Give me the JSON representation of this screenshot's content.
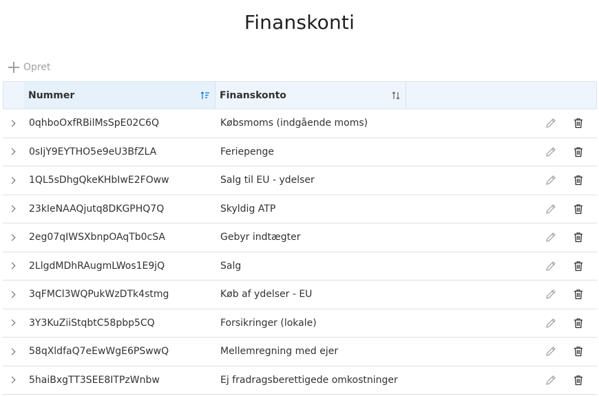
{
  "page": {
    "title": "Finanskonti"
  },
  "toolbar": {
    "create_label": "Opret"
  },
  "grid": {
    "columns": [
      {
        "label": "Nummer",
        "sort": "ascending"
      },
      {
        "label": "Finanskonto",
        "sort": "none"
      }
    ],
    "rows": [
      {
        "number": "0qhboOxfRBilMsSpE02C6Q",
        "name": "Købsmoms (indgående moms)"
      },
      {
        "number": "0sIjY9EYTHO5e9eU3BfZLA",
        "name": "Feriepenge"
      },
      {
        "number": "1QL5sDhgQkeKHbIwE2FOww",
        "name": "Salg til EU - ydelser"
      },
      {
        "number": "23kIeNAAQjutq8DKGPHQ7Q",
        "name": "Skyldig ATP"
      },
      {
        "number": "2eg07qIWSXbnpOAqTb0cSA",
        "name": "Gebyr indtægter"
      },
      {
        "number": "2LlgdMDhRAugmLWos1E9jQ",
        "name": "Salg"
      },
      {
        "number": "3qFMCl3WQPukWzDTk4stmg",
        "name": "Køb af ydelser - EU"
      },
      {
        "number": "3Y3KuZiiStqbtC58pbp5CQ",
        "name": "Forsikringer (lokale)"
      },
      {
        "number": "58qXldfaQ7eEwWgE6PSwwQ",
        "name": "Mellemregning med ejer"
      },
      {
        "number": "5haiBxgTT3SEE8ITPzWnbw",
        "name": "Ej fradragsberettigede omkostninger"
      }
    ]
  },
  "icons": {
    "create": "plus-icon",
    "expand": "chevron-right-icon",
    "edit": "pencil-icon",
    "delete": "trash-icon",
    "sort_asc": "sort-ascending-icon",
    "sort_none": "sort-icon"
  },
  "colors": {
    "header_bg": "#eef5fc",
    "disabled_text": "#a19f9d"
  }
}
